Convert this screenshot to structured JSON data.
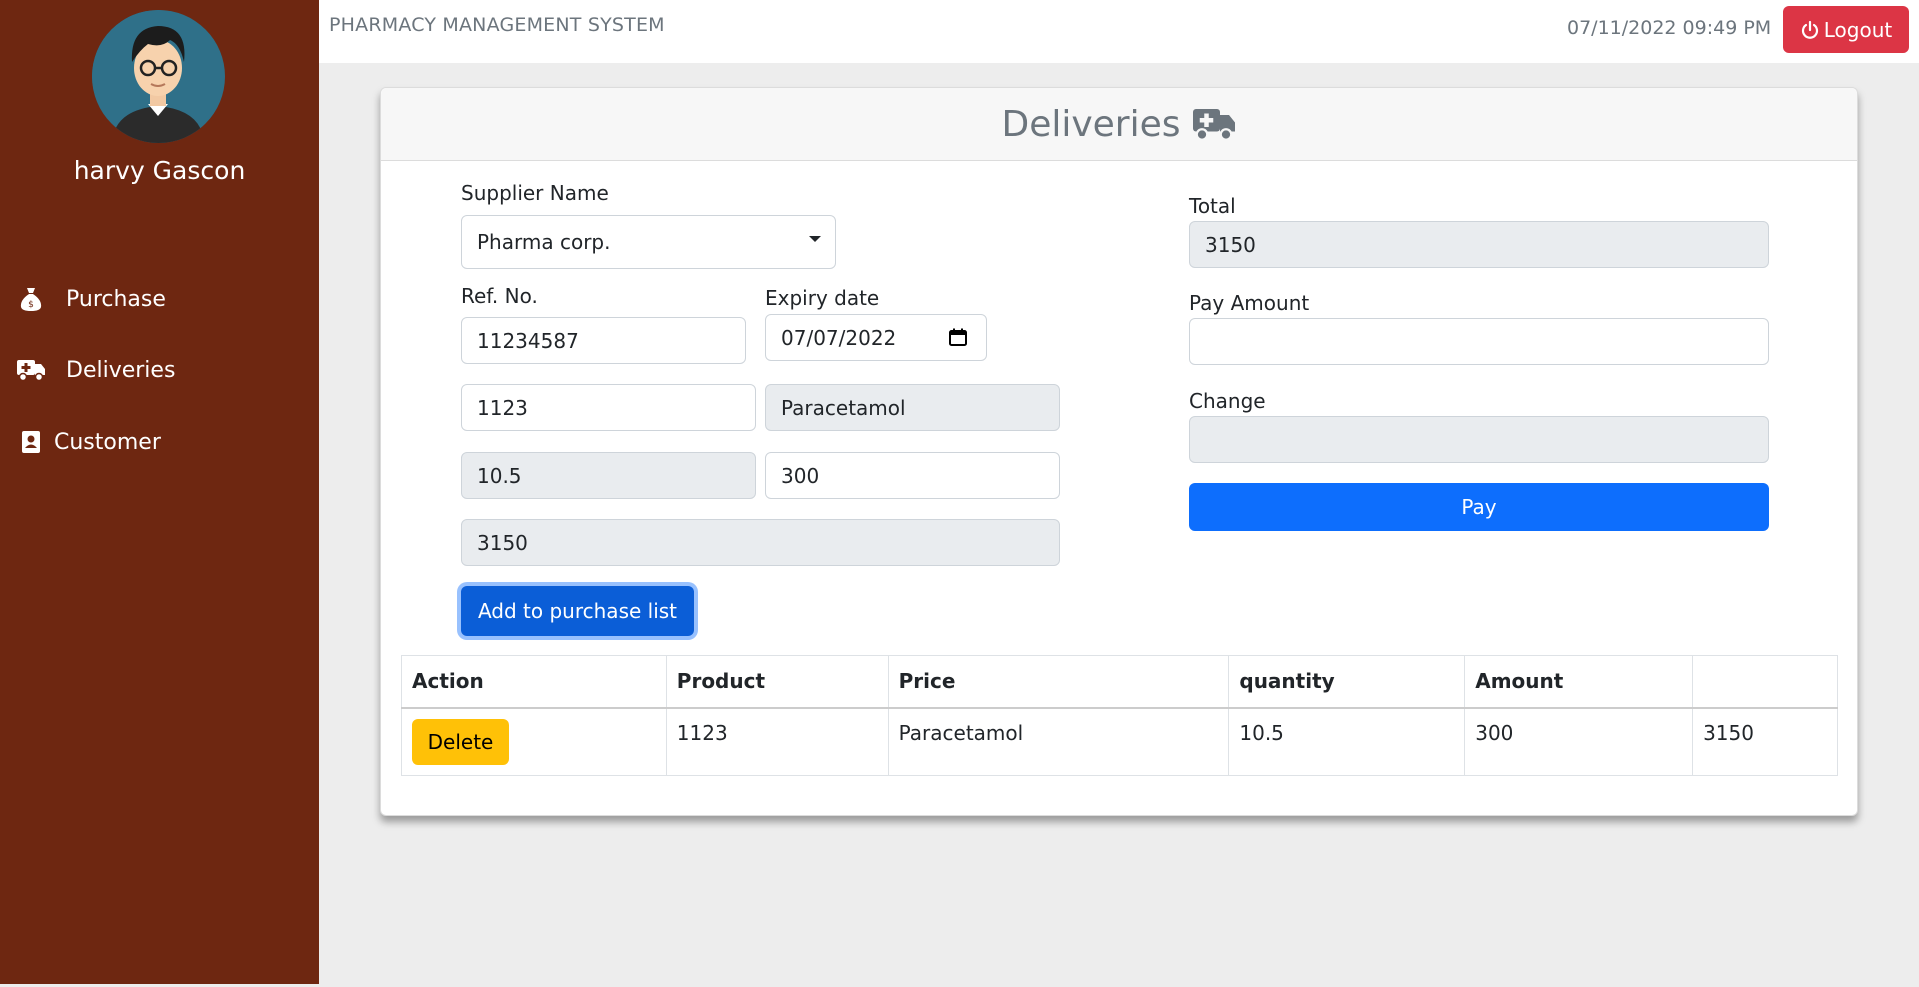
{
  "sidebar": {
    "user_name": "harvy Gascon",
    "items": [
      {
        "label": "Purchase",
        "icon": "money-bag-icon"
      },
      {
        "label": "Deliveries",
        "icon": "ambulance-truck-icon"
      },
      {
        "label": "Customer",
        "icon": "contact-card-icon"
      }
    ],
    "background": "#6e2711"
  },
  "topbar": {
    "title": "PHARMACY MANAGEMENT SYSTEM",
    "datetime": "07/11/2022 09:49 PM",
    "logout_label": "Logout"
  },
  "card": {
    "title": "Deliveries",
    "form": {
      "supplier_label": "Supplier Name",
      "supplier_value": "Pharma corp.",
      "ref_label": "Ref. No.",
      "ref_value": "11234587",
      "expiry_label": "Expiry date",
      "expiry_value": "07/07/2022",
      "product_code": "1123",
      "product_name": "Paracetamol",
      "price": "10.5",
      "quantity": "300",
      "amount": "3150",
      "add_button": "Add to purchase list"
    },
    "payment": {
      "total_label": "Total",
      "total_value": "3150",
      "pay_amount_label": "Pay Amount",
      "pay_amount_value": "",
      "change_label": "Change",
      "change_value": "",
      "pay_button": "Pay"
    },
    "table": {
      "headers": [
        "Action",
        "Product",
        "Price",
        "quantity",
        "Amount",
        ""
      ],
      "rows": [
        {
          "action": "Delete",
          "product": "1123",
          "price": "Paracetamol",
          "quantity": "10.5",
          "amount": "300",
          "extra": "3150"
        }
      ]
    }
  },
  "colors": {
    "danger": "#dc3545",
    "primary": "#0d6efd",
    "warning": "#ffc107"
  }
}
